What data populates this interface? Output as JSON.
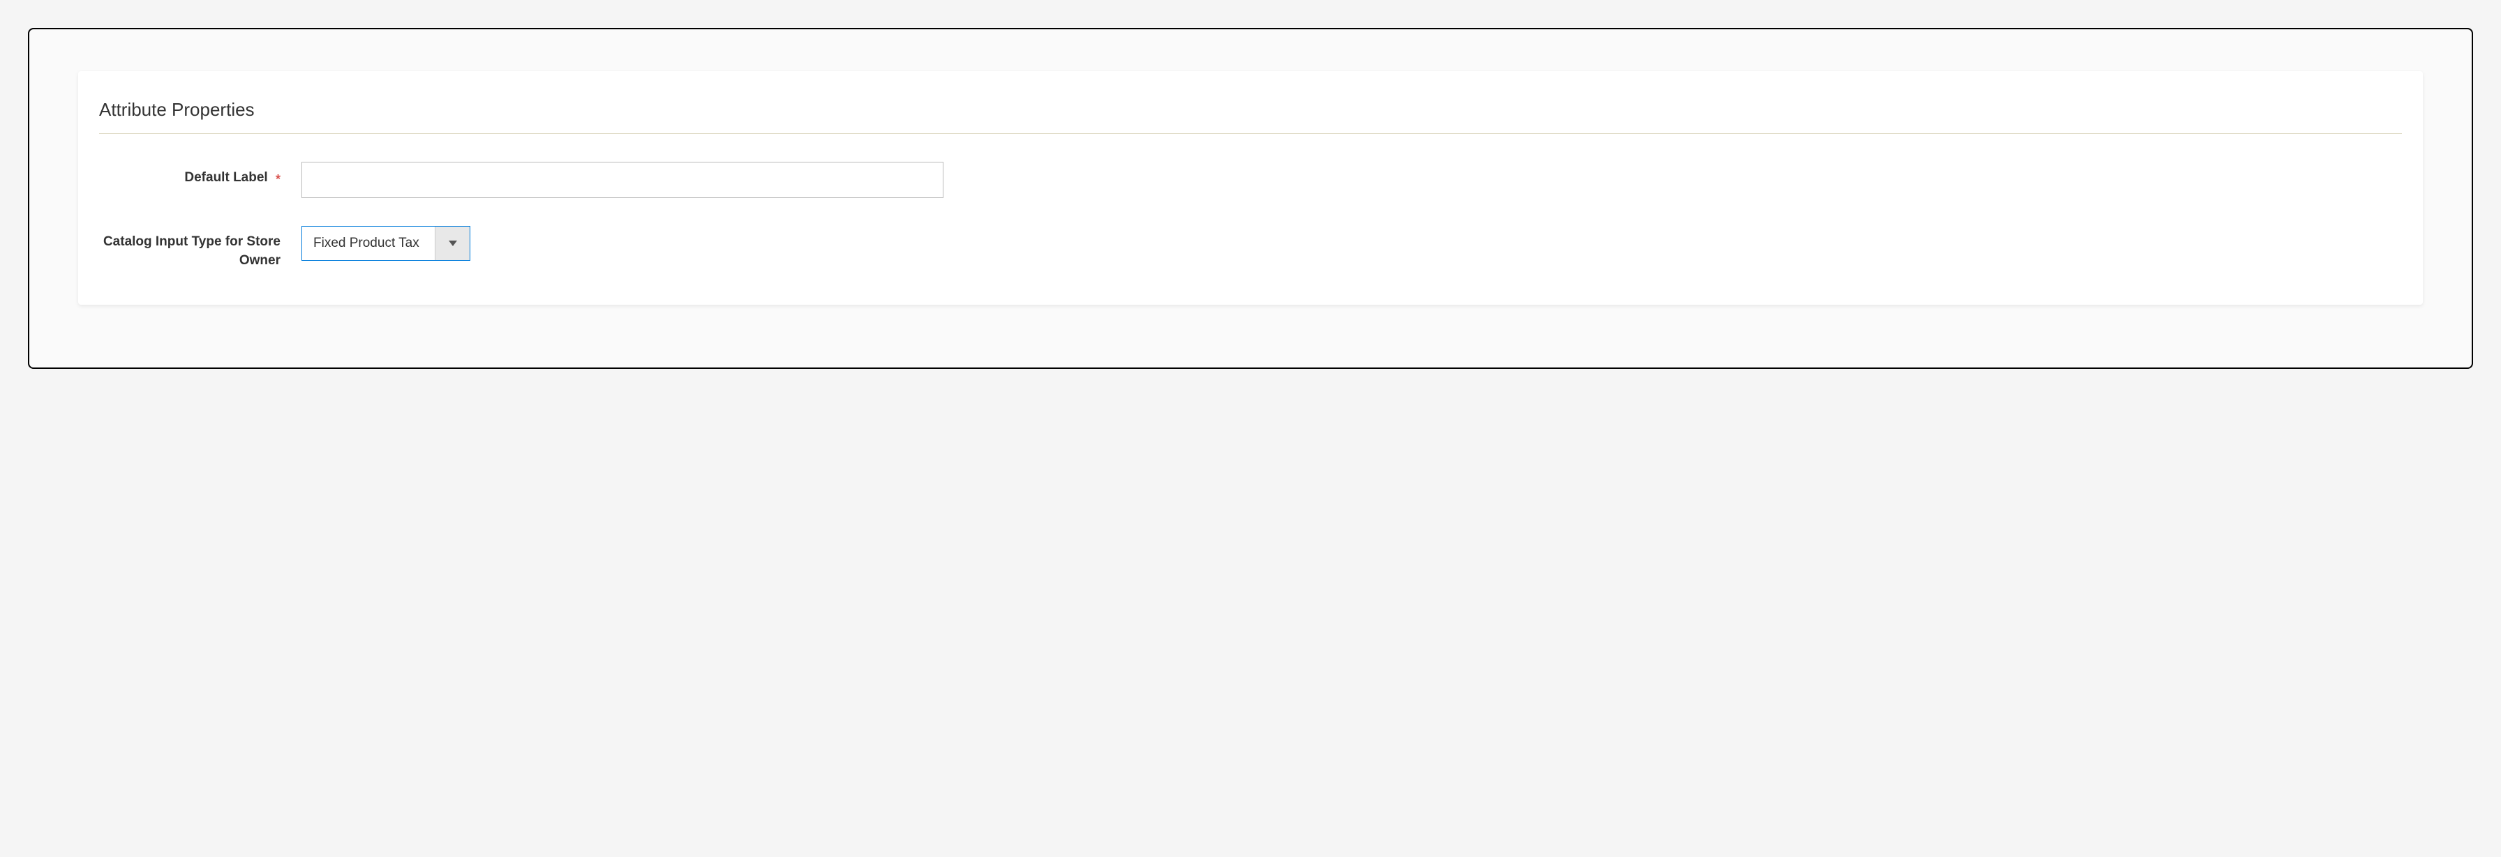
{
  "section": {
    "title": "Attribute Properties"
  },
  "fields": {
    "defaultLabel": {
      "label": "Default Label",
      "required": true,
      "value": ""
    },
    "catalogInputType": {
      "label": "Catalog Input Type for Store Owner",
      "required": false,
      "selected": "Fixed Product Tax"
    }
  }
}
